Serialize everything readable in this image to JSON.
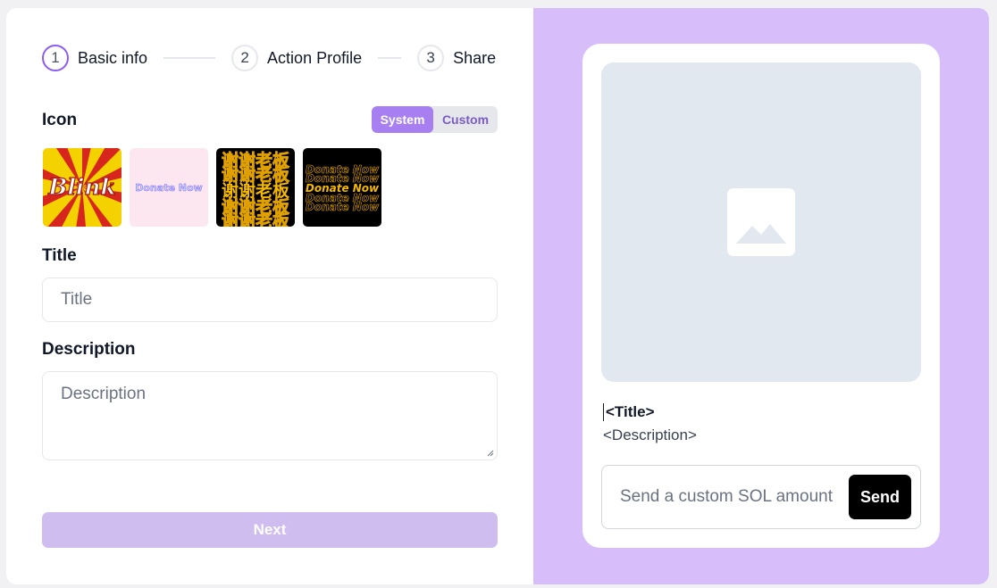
{
  "stepper": {
    "steps": [
      {
        "number": "1",
        "label": "Basic info",
        "active": true
      },
      {
        "number": "2",
        "label": "Action Profile",
        "active": false
      },
      {
        "number": "3",
        "label": "Share",
        "active": false
      }
    ]
  },
  "form": {
    "icon_label": "Icon",
    "toggle": {
      "system": "System",
      "custom": "Custom",
      "selected": "System"
    },
    "icons": [
      {
        "name": "blink",
        "text": "Blink"
      },
      {
        "name": "donate-now-pink",
        "text": "Donate Now"
      },
      {
        "name": "xiexie-laoban",
        "text": "谢谢老板"
      },
      {
        "name": "donate-now-black",
        "text": "Donate Now"
      }
    ],
    "title_label": "Title",
    "title_placeholder": "Title",
    "description_label": "Description",
    "description_placeholder": "Description",
    "next_label": "Next"
  },
  "preview": {
    "title": "<Title>",
    "description": "<Description>",
    "send_placeholder": "Send a custom SOL amount",
    "send_label": "Send"
  },
  "colors": {
    "accent": "#8b5cf6",
    "panel_bg": "#d8bdfb",
    "next_disabled": "#cfbdf0"
  }
}
